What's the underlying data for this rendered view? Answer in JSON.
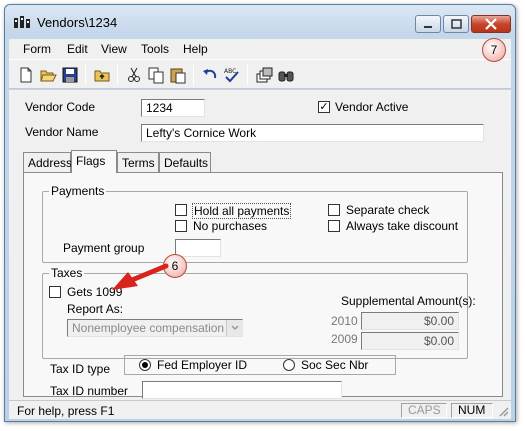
{
  "window": {
    "title": "Vendors\\1234"
  },
  "menu": {
    "items": [
      "Form",
      "Edit",
      "View",
      "Tools",
      "Help"
    ]
  },
  "toolbar": {
    "icons": [
      "new-icon",
      "open-icon",
      "save-icon",
      "up-folder-icon",
      "cut-icon",
      "copy-icon",
      "paste-icon",
      "undo-icon",
      "spellcheck-icon",
      "layers-icon",
      "find-icon"
    ]
  },
  "vendor": {
    "code_label": "Vendor Code",
    "code_value": "1234",
    "active_label": "Vendor Active",
    "active_checked": true,
    "name_label": "Vendor Name",
    "name_value": "Lefty's Cornice Work"
  },
  "tabs": [
    {
      "label": "Address",
      "active": false
    },
    {
      "label": "Flags",
      "active": true
    },
    {
      "label": "Terms",
      "active": false
    },
    {
      "label": "Defaults",
      "active": false
    }
  ],
  "payments": {
    "title": "Payments",
    "hold_all": "Hold all payments",
    "no_purchases": "No purchases",
    "separate_check": "Separate check",
    "always_discount": "Always take discount",
    "group_label": "Payment group",
    "group_value": ""
  },
  "taxes": {
    "title": "Taxes",
    "gets_1099": "Gets 1099",
    "report_as_label": "Report As:",
    "report_as_value": "Nonemployee compensation",
    "supplemental_label": "Supplemental Amount(s):",
    "years": [
      {
        "year": "2010",
        "amount": "$0.00"
      },
      {
        "year": "2009",
        "amount": "$0.00"
      }
    ],
    "tax_id_type_label": "Tax ID type",
    "fed_employer_id": "Fed Employer ID",
    "soc_sec_nbr": "Soc Sec Nbr",
    "tax_id_number_label": "Tax ID number",
    "tax_id_number_value": ""
  },
  "callouts": {
    "six": "6",
    "seven": "7"
  },
  "status": {
    "help": "For help, press F1",
    "caps": "CAPS",
    "num": "NUM"
  },
  "colors": {
    "arrow": "#d8241c"
  }
}
